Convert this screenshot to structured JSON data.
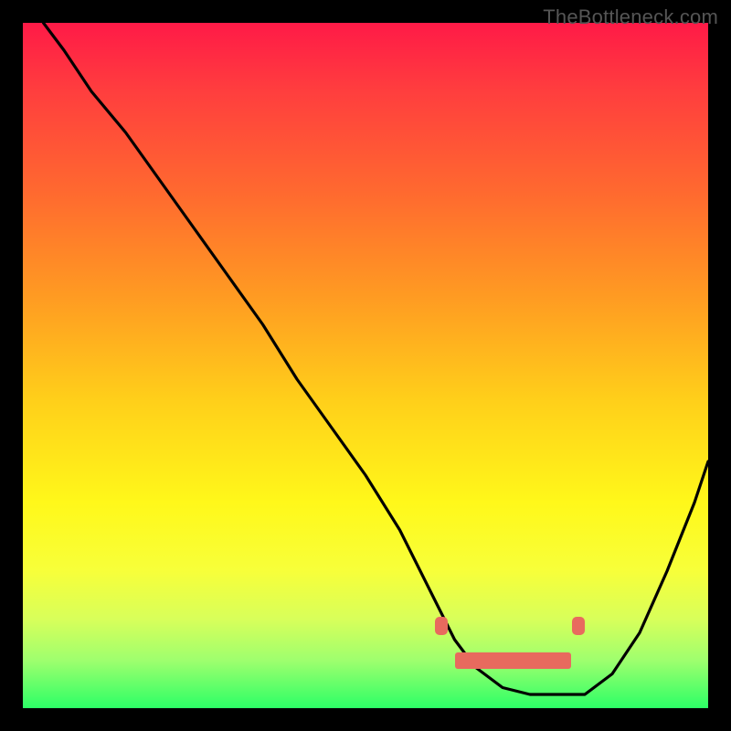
{
  "watermark": "TheBottleneck.com",
  "chart_data": {
    "type": "line",
    "title": "",
    "xlabel": "",
    "ylabel": "",
    "xlim": [
      0,
      100
    ],
    "ylim": [
      0,
      100
    ],
    "grid": false,
    "series": [
      {
        "name": "bottleneck-curve",
        "x": [
          3,
          6,
          10,
          15,
          20,
          25,
          30,
          35,
          40,
          45,
          50,
          55,
          58,
          60,
          63,
          66,
          70,
          74,
          78,
          82,
          86,
          90,
          94,
          98,
          100
        ],
        "values": [
          100,
          96,
          90,
          84,
          77,
          70,
          63,
          56,
          48,
          41,
          34,
          26,
          20,
          16,
          10,
          6,
          3,
          2,
          2,
          2,
          5,
          11,
          20,
          30,
          36
        ]
      }
    ],
    "markers": [
      {
        "name": "optimal-left",
        "x": 61,
        "y": 12,
        "color": "#e86a5e"
      },
      {
        "name": "optimal-right",
        "x": 81,
        "y": 12,
        "color": "#e86a5e"
      },
      {
        "name": "optimal-band",
        "x0": 63,
        "x1": 80,
        "y": 7,
        "color": "#e86a5e"
      }
    ],
    "colors": {
      "curve": "#000000",
      "marker": "#e86a5e",
      "background_top": "#ff1a47",
      "background_bottom": "#2cff66",
      "frame": "#000000"
    }
  }
}
